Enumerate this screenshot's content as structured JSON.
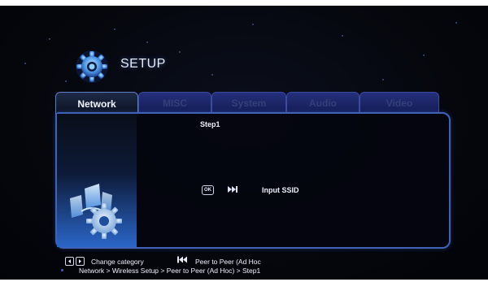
{
  "header": {
    "title": "SETUP",
    "icon": "gear-icon"
  },
  "tabs": [
    {
      "label": "Network",
      "active": true
    },
    {
      "label": "MISC",
      "active": false
    },
    {
      "label": "System",
      "active": false
    },
    {
      "label": "Audio",
      "active": false
    },
    {
      "label": "Video",
      "active": false
    }
  ],
  "panel": {
    "step": "Step1",
    "ok_key": "OK",
    "input_label": "Input SSID"
  },
  "footer": {
    "change_label": "Change category",
    "p2p_label": "Peer to Peer (Ad Hoc",
    "breadcrumb": "Network > Wireless Setup > Peer to Peer (Ad Hoc) > Step1"
  },
  "colors": {
    "background": "#05070d",
    "panel_border": "#3f63b8",
    "inactive_tab": "#24307c",
    "text": "#eef1fb"
  }
}
